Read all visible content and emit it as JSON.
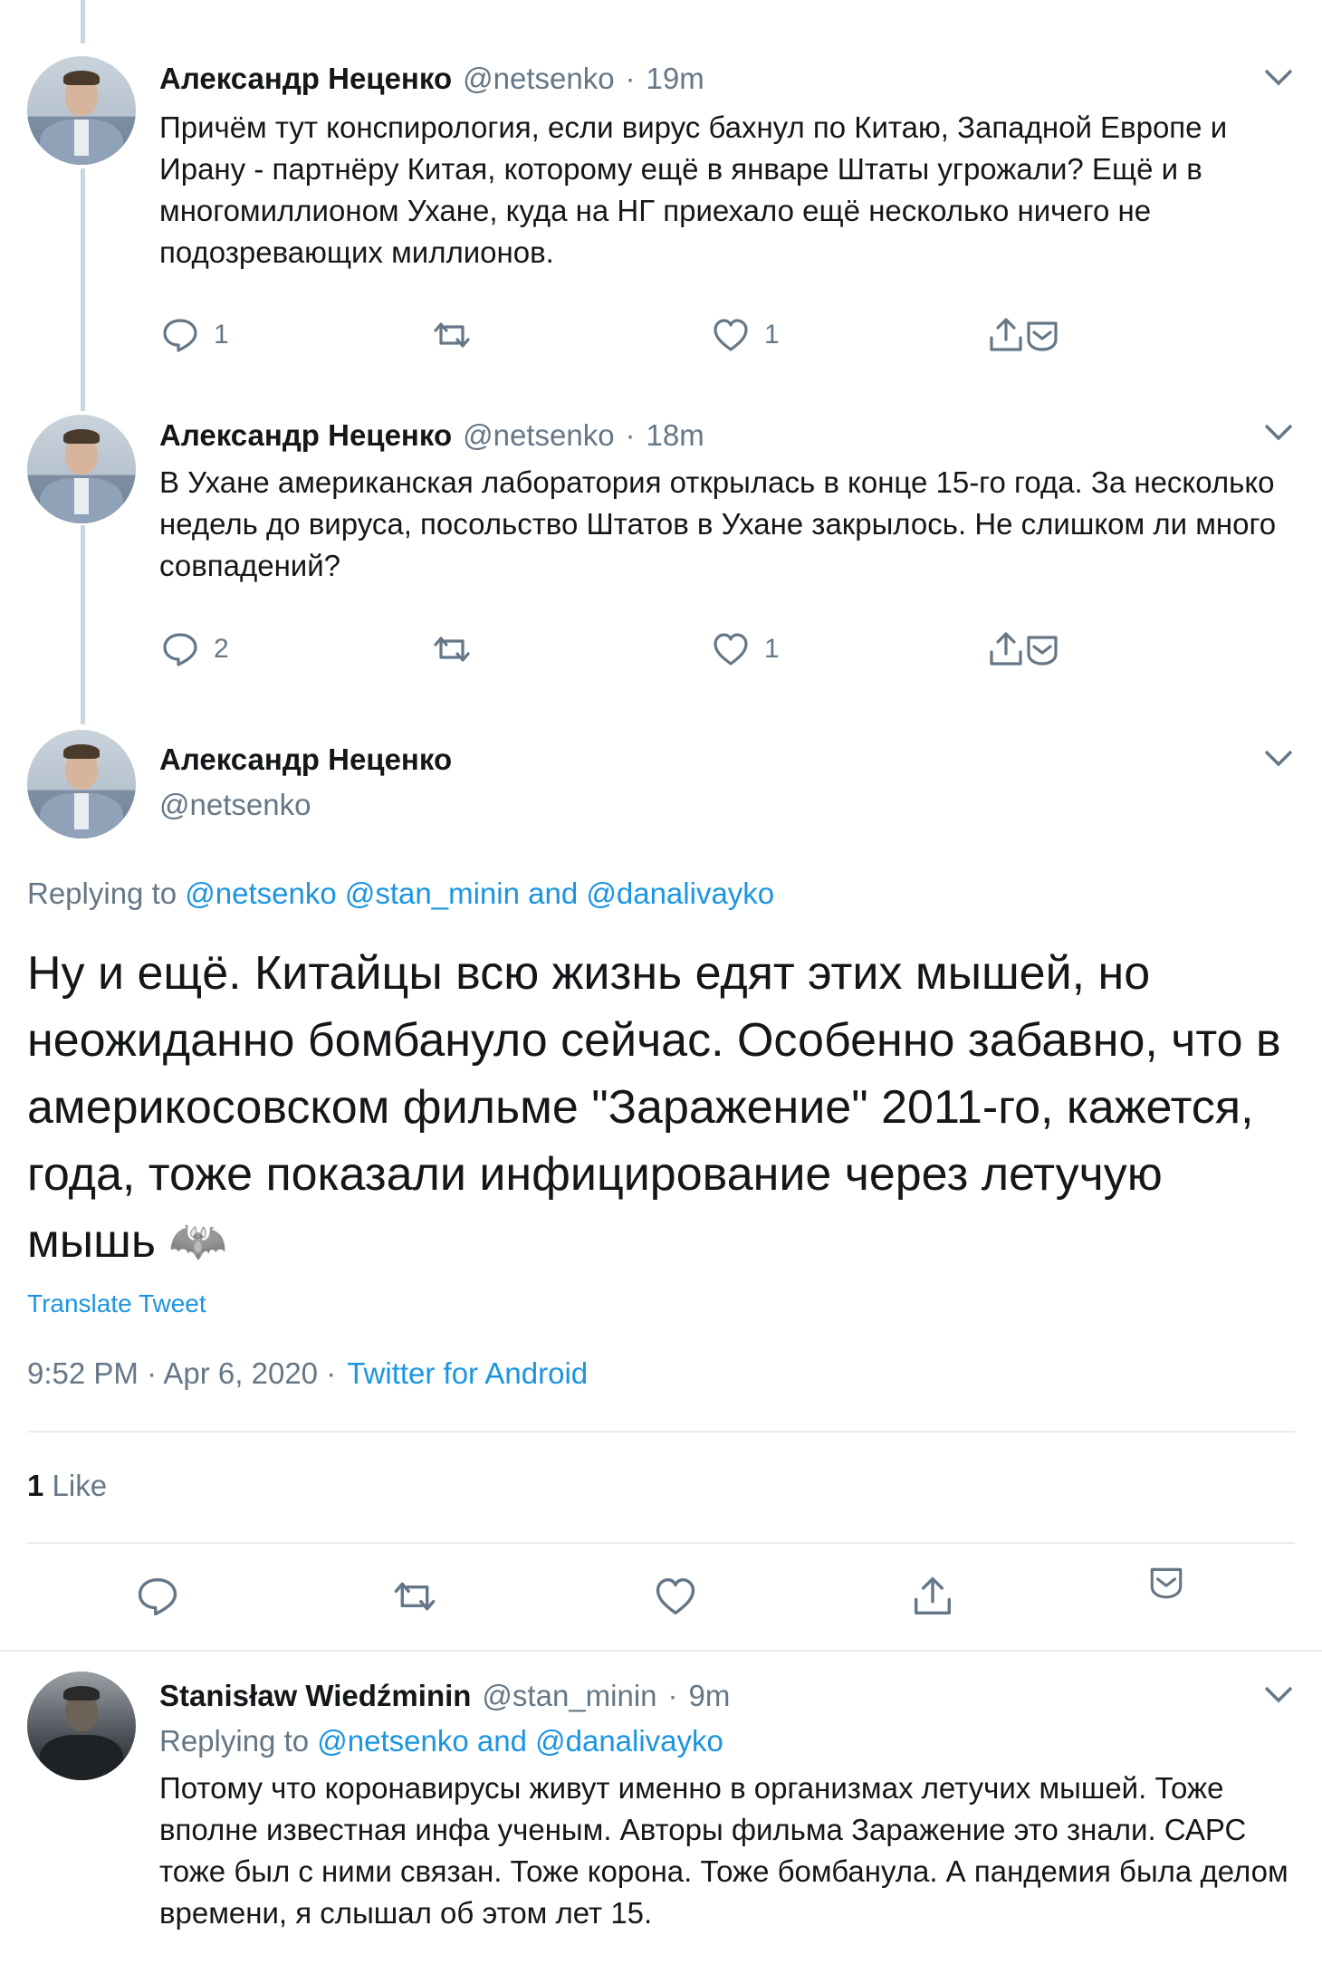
{
  "tweet1": {
    "name": "Александр Неценко",
    "handle": "@netsenko",
    "sep": "·",
    "time": "19m",
    "text": "Причём тут конспирология, если вирус бахнул по Китаю, Западной Европе и Ирану - партнёру Китая, которому ещё в январе Штаты угрожали? Ещё и в многомиллионом Ухане, куда на НГ приехало ещё несколько ничего не подозревающих миллионов.",
    "replies": "1",
    "likes": "1"
  },
  "tweet2": {
    "name": "Александр Неценко",
    "handle": "@netsenko",
    "sep": "·",
    "time": "18m",
    "text": "В Ухане американская лаборатория открылась в конце 15-го года. За несколько недель до вируса, посольство Штатов в Ухане закрылось. Не слишком ли много совпадений?",
    "replies": "2",
    "likes": "1"
  },
  "main": {
    "name": "Александр Неценко",
    "handle": "@netsenko",
    "replying_prefix": "Replying to",
    "replying_to": "@netsenko @stan_minin and @danalivayko",
    "text": "Ну и ещё. Китайцы всю жизнь едят этих мышей, но неожиданно бомбануло сейчас. Особенно забавно, что в америкосовском фильме \"Заражение\" 2011-го, кажется, года, тоже показали инфицирование через летучую мышь",
    "emoji": "🦇",
    "translate": "Translate Tweet",
    "timestamp": "9:52 PM · Apr 6, 2020 ·",
    "source": "Twitter for Android",
    "like_count": "1",
    "like_label": "Like"
  },
  "reply": {
    "name": "Stanisław Wiedźminin",
    "handle": "@stan_minin",
    "sep": "·",
    "time": "9m",
    "replying_prefix": "Replying to",
    "replying_to": "@netsenko and @danalivayko",
    "text": "Потому что коронавирусы живут именно в организмах летучих мышей. Тоже вполне известная инфа ученым. Авторы фильма Заражение это знали. САРС тоже был с ними связан. Тоже корона. Тоже бомбанула. А пандемия была делом времени, я слышал об этом лет 15."
  },
  "colors": {
    "link": "#1b95e0",
    "muted": "#657786",
    "text": "#14171a",
    "icon": "#657786"
  }
}
